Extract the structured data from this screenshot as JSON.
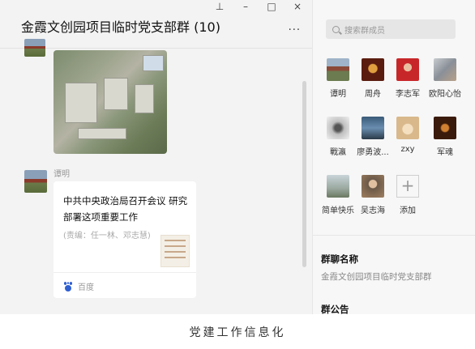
{
  "chat": {
    "title": "金霞文创园项目临时党支部群 (10)",
    "more": "···",
    "window_controls": {
      "pin": "⊥",
      "minimize": "–",
      "maximize": "□",
      "close": "×"
    },
    "messages": {
      "photo_alt": "construction-site-aerial-photo",
      "sender": "谭明",
      "link": {
        "title": "中共中央政治局召开会议 研究部署这项重要工作",
        "description": "(责编：任一林、邓志慧)",
        "source": "百度"
      }
    }
  },
  "members": {
    "search_placeholder": "搜索群成员",
    "list": [
      {
        "name": "谭明",
        "color": "#8b4a38"
      },
      {
        "name": "周舟",
        "color": "#5a1c0f"
      },
      {
        "name": "李志军",
        "color": "#c8272a"
      },
      {
        "name": "欧阳心怡",
        "color": "#a0a7b0"
      },
      {
        "name": "戰瀛",
        "color": "#b8b8b8"
      },
      {
        "name": "廖勇波...",
        "color": "#4c6e8a"
      },
      {
        "name": "zxy",
        "color": "#d9b88c"
      },
      {
        "name": "军魂",
        "color": "#3a1a0a"
      },
      {
        "name": "简单快乐",
        "color": "#9aa8a0"
      },
      {
        "name": "吴志海",
        "color": "#6a5848"
      },
      {
        "name": "添加",
        "color": ""
      }
    ],
    "group_name_label": "群聊名称",
    "group_name_value": "金霞文创园项目临时党支部群",
    "notice_label": "群公告"
  },
  "caption": "党建工作信息化"
}
